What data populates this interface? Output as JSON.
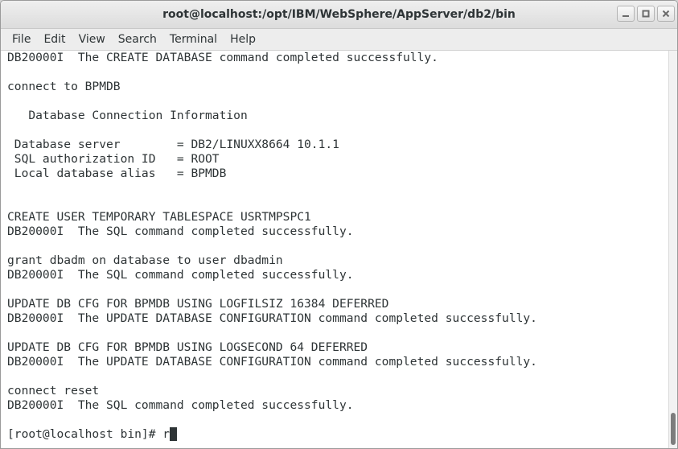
{
  "window": {
    "title": "root@localhost:/opt/IBM/WebSphere/AppServer/db2/bin",
    "controls": [
      "minimize-icon",
      "maximize-icon",
      "close-icon"
    ]
  },
  "menu": [
    "File",
    "Edit",
    "View",
    "Search",
    "Terminal",
    "Help"
  ],
  "terminal": {
    "lines": [
      "DB20000I  The CREATE DATABASE command completed successfully.",
      "",
      "connect to BPMDB",
      "",
      "   Database Connection Information",
      "",
      " Database server        = DB2/LINUXX8664 10.1.1",
      " SQL authorization ID   = ROOT",
      " Local database alias   = BPMDB",
      "",
      "",
      "CREATE USER TEMPORARY TABLESPACE USRTMPSPC1",
      "DB20000I  The SQL command completed successfully.",
      "",
      "grant dbadm on database to user dbadmin",
      "DB20000I  The SQL command completed successfully.",
      "",
      "UPDATE DB CFG FOR BPMDB USING LOGFILSIZ 16384 DEFERRED",
      "DB20000I  The UPDATE DATABASE CONFIGURATION command completed successfully.",
      "",
      "UPDATE DB CFG FOR BPMDB USING LOGSECOND 64 DEFERRED",
      "DB20000I  The UPDATE DATABASE CONFIGURATION command completed successfully.",
      "",
      "connect reset",
      "DB20000I  The SQL command completed successfully.",
      ""
    ],
    "prompt": "[root@localhost bin]# ",
    "input": "r"
  },
  "colors": {
    "text": "#2e3436",
    "background": "#ffffff",
    "titlebar": "#e3e3e3",
    "menubar": "#ededed"
  }
}
